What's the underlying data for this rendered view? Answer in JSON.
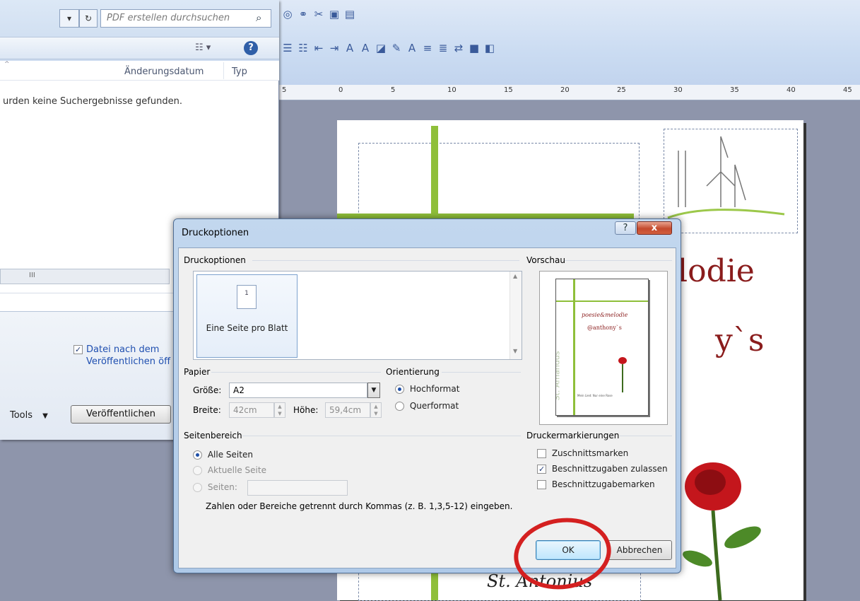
{
  "explorer": {
    "search_placeholder": "PDF erstellen durchsuchen",
    "column_date": "Änderungsdatum",
    "column_type": "Typ",
    "no_results": "urden keine Suchergebnisse gefunden.",
    "scroll_glyph": "III",
    "open_after_publish_line1": "Datei nach dem",
    "open_after_publish_line2": "Veröffentlichen öff",
    "open_after_publish_checked": true,
    "tools_label": "Tools",
    "publish_button": "Veröffentlichen"
  },
  "publisher": {
    "ruler_labels": [
      "5",
      "0",
      "5",
      "10",
      "15",
      "20",
      "25",
      "30",
      "35",
      "40",
      "45"
    ],
    "page_text_1": "lodie",
    "page_text_2": "y`s",
    "page_text_3": "St. Antonius"
  },
  "dialog": {
    "title": "Druckoptionen",
    "help_glyph": "?",
    "close_glyph": "x",
    "group_print_options": "Druckoptionen",
    "option_page_number": "1",
    "option_label": "Eine Seite pro Blatt",
    "group_preview": "Vorschau",
    "group_paper": "Papier",
    "size_label": "Größe:",
    "size_value": "A2",
    "width_label": "Breite:",
    "width_value": "42cm",
    "height_label": "Höhe:",
    "height_value": "59,4cm",
    "group_orientation": "Orientierung",
    "orientation_portrait": "Hochformat",
    "orientation_landscape": "Querformat",
    "orientation_selected": "Hochformat",
    "group_page_range": "Seitenbereich",
    "range_all": "Alle Seiten",
    "range_current": "Aktuelle Seite",
    "range_pages": "Seiten:",
    "range_hint": "Zahlen oder Bereiche getrennt durch Kommas (z. B. 1,3,5-12) eingeben.",
    "group_printer_marks": "Druckermarkierungen",
    "mark_crop": "Zuschnittsmarken",
    "mark_crop_checked": false,
    "mark_bleed": "Beschnittzugaben zulassen",
    "mark_bleed_checked": true,
    "mark_bleed_marks": "Beschnittzugabemarken",
    "mark_bleed_marks_checked": false,
    "ok_button": "OK",
    "cancel_button": "Abbrechen",
    "preview_text": {
      "line1": "poesie&melodie",
      "line2": "@anthony`s",
      "side": "St. Amandus",
      "quote": "Mein Lied: Nur eine Rose"
    }
  },
  "colors": {
    "accent_red": "#d42020",
    "guide_green": "#8fbf3a",
    "text_dark_red": "#8a1c1c"
  }
}
